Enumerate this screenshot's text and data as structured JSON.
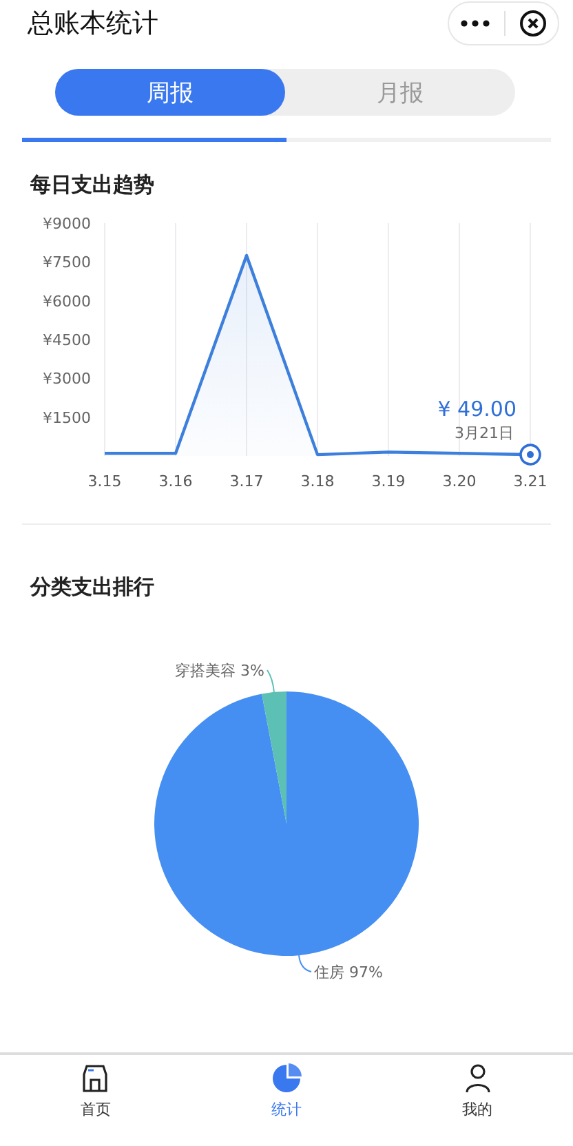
{
  "header": {
    "title": "总账本统计"
  },
  "tabs": [
    {
      "label": "周报",
      "selected": true
    },
    {
      "label": "月报",
      "selected": false
    }
  ],
  "trend": {
    "title": "每日支出趋势",
    "chart_data": {
      "type": "line",
      "categories": [
        "3.15",
        "3.16",
        "3.17",
        "3.18",
        "3.19",
        "3.20",
        "3.21"
      ],
      "ylim": [
        0,
        9000
      ],
      "yticks": [
        {
          "value": 1500,
          "label": "¥1500"
        },
        {
          "value": 3000,
          "label": "¥3000"
        },
        {
          "value": 4500,
          "label": "¥4500"
        },
        {
          "value": 6000,
          "label": "¥6000"
        },
        {
          "value": 7500,
          "label": "¥7500"
        },
        {
          "value": 9000,
          "label": "¥9000"
        }
      ],
      "grid": true,
      "series": [
        {
          "color": "#3d7fdc",
          "values": [
            100,
            100,
            7750,
            50,
            150,
            100,
            50
          ]
        }
      ],
      "annotations": [
        "¥ 49.00",
        "3月21日"
      ]
    }
  },
  "category": {
    "title": "分类支出排行",
    "chart_data": {
      "type": "pie",
      "colors": [
        "#458ff2",
        "#5cc0b5"
      ],
      "values": [
        97,
        3
      ],
      "value_labels": [
        "住房 97%",
        "穿搭美容 3%"
      ]
    }
  },
  "tabbar": [
    {
      "label": "首页",
      "kind": "home",
      "selected": false
    },
    {
      "label": "统计",
      "kind": "pie",
      "selected": true
    },
    {
      "label": "我的",
      "kind": "person",
      "selected": false
    }
  ]
}
